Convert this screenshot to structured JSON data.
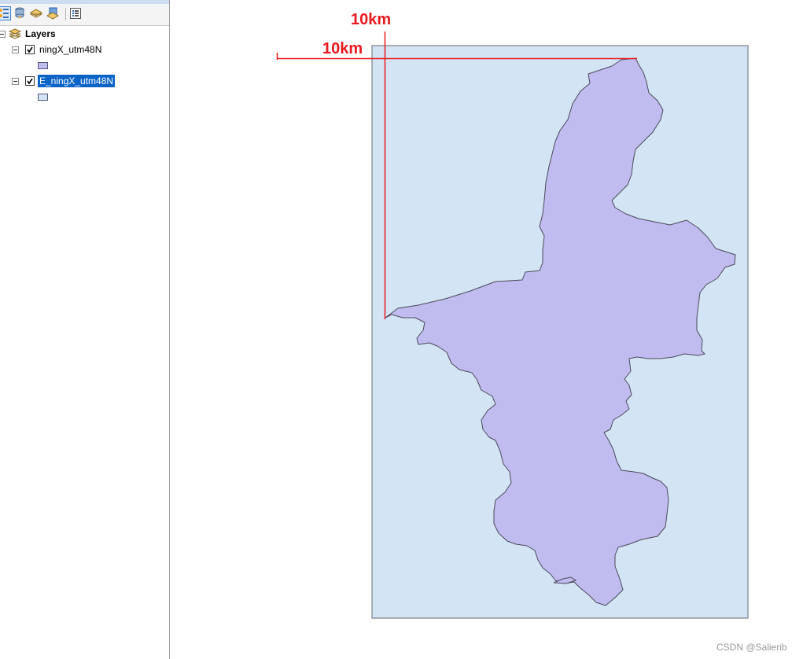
{
  "toc": {
    "toolbar": {
      "buttons": [
        {
          "icon": "list-by-drawing-order-icon"
        },
        {
          "icon": "list-by-source-icon"
        },
        {
          "icon": "list-by-visibility-icon"
        },
        {
          "icon": "list-by-selection-icon"
        },
        {
          "icon": "options-icon"
        }
      ]
    },
    "root": {
      "label": "Layers",
      "icon": "layers-stack-icon"
    },
    "layers": [
      {
        "label": "ningX_utm48N",
        "checked": true,
        "selected": false,
        "swatch_fill": "#c0bcf0"
      },
      {
        "label": "E_ningX_utm48N",
        "checked": true,
        "selected": true,
        "swatch_fill": "#d3e4f4"
      }
    ]
  },
  "map": {
    "extent_fill": "#d3e4f4",
    "boundary_fill": "#c0bcf0",
    "annotation_color": "#e8191e",
    "annotations": {
      "vertical_label": "10km",
      "horizontal_label": "10km"
    }
  },
  "watermark": "CSDN @Salierib"
}
